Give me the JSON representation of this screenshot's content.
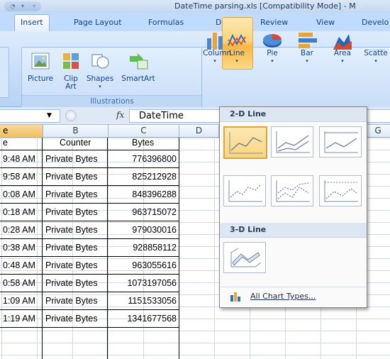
{
  "window": {
    "title": "DateTime parsing.xls  [Compatibility Mode]  -  M"
  },
  "tabs": [
    "Insert",
    "Page Layout",
    "Formulas",
    "Data",
    "Review",
    "View",
    "Develo"
  ],
  "ribbon": {
    "picture": "Picture",
    "clip_art_1": "Clip",
    "clip_art_2": "Art",
    "shapes": "Shapes",
    "smartart": "SmartArt",
    "illustrations": "Illustrations",
    "column": "Column",
    "line": "Line",
    "pie": "Pie",
    "bar": "Bar",
    "area": "Area",
    "scatter": "Scatte"
  },
  "formula_bar": {
    "fx": "fx",
    "value": "DateTime"
  },
  "columns": [
    "e",
    "B",
    "C",
    "D",
    "G"
  ],
  "sheet": {
    "header": {
      "a": "e",
      "b": "Counter",
      "c": "Bytes"
    },
    "rows": [
      {
        "a": "9:48 AM",
        "b": "Private Bytes",
        "c": "776396800"
      },
      {
        "a": "9:58 AM",
        "b": "Private Bytes",
        "c": "825212928"
      },
      {
        "a": "0:08 AM",
        "b": "Private Bytes",
        "c": "848396288"
      },
      {
        "a": "0:18 AM",
        "b": "Private Bytes",
        "c": "963715072"
      },
      {
        "a": "0:28 AM",
        "b": "Private Bytes",
        "c": "979030016"
      },
      {
        "a": "0:38 AM",
        "b": "Private Bytes",
        "c": "928858112"
      },
      {
        "a": "0:48 AM",
        "b": "Private Bytes",
        "c": "963055616"
      },
      {
        "a": "0:58 AM",
        "b": "Private Bytes",
        "c": "1073197056"
      },
      {
        "a": "1:09 AM",
        "b": "Private Bytes",
        "c": "1151533056"
      },
      {
        "a": "1:19 AM",
        "b": "Private Bytes",
        "c": "1341677568"
      }
    ]
  },
  "dropdown": {
    "section_2d": "2-D Line",
    "section_3d": "3-D Line",
    "all_chart_types": "All Chart Types..."
  }
}
